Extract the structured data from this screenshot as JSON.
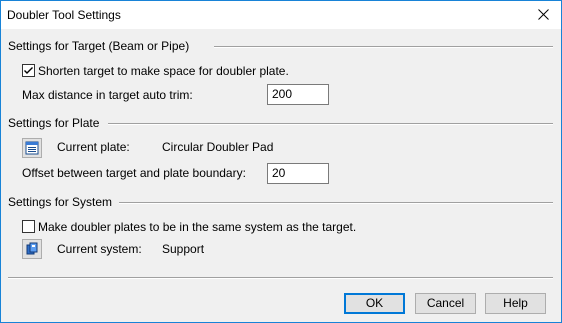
{
  "window": {
    "title": "Doubler Tool Settings",
    "close_glyph": "×"
  },
  "target": {
    "section_title": "Settings for Target (Beam or Pipe)",
    "shorten_checkbox_label": "Shorten target to make space for doubler plate.",
    "shorten_checked": true,
    "max_distance_label": "Max distance in target auto trim:",
    "max_distance_value": "200"
  },
  "plate": {
    "section_title": "Settings for Plate",
    "current_plate_label": "Current plate:",
    "current_plate_value": "Circular Doubler Pad",
    "offset_label": "Offset between target and plate boundary:",
    "offset_value": "20"
  },
  "system": {
    "section_title": "Settings for System",
    "same_system_checkbox_label": "Make doubler plates to be in the same system as the target.",
    "same_system_checked": false,
    "current_system_label": "Current system:",
    "current_system_value": "Support"
  },
  "buttons": {
    "ok": "OK",
    "cancel": "Cancel",
    "help": "Help"
  },
  "colors": {
    "accent": "#0078d7",
    "window_border": "#1883d7",
    "dialog_bg": "#f0f0f0"
  }
}
